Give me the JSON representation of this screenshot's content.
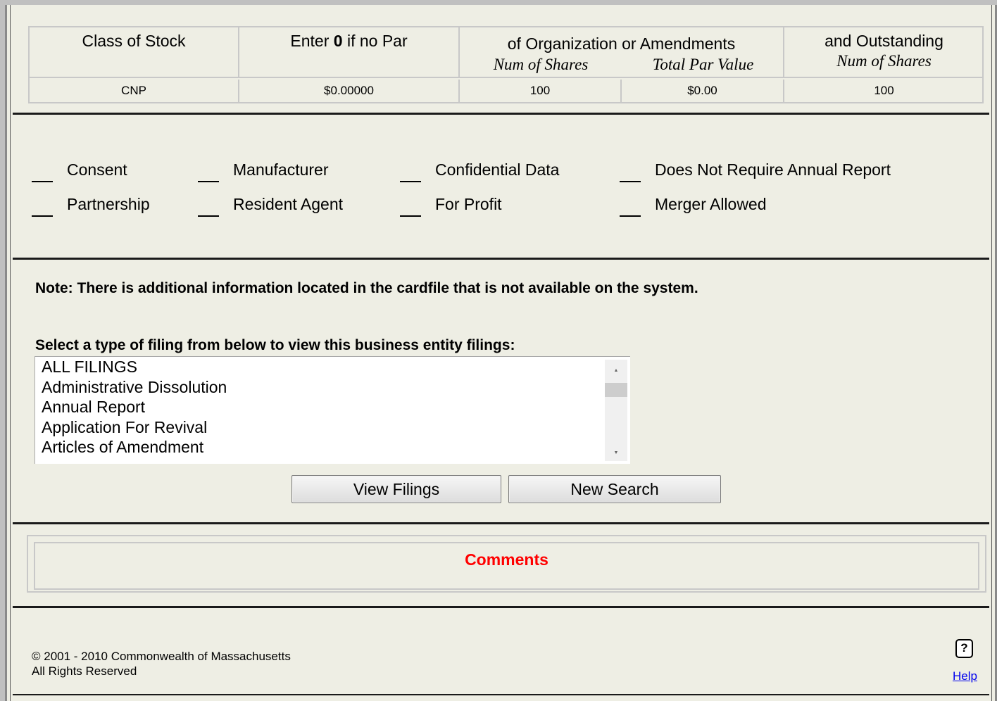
{
  "stock_table": {
    "headers": {
      "class": "Class of Stock",
      "par_prefix": "Enter",
      "par_bold": "0",
      "par_suffix": "if no Par",
      "org": "of Organization or Amendments",
      "org_shares": "Num of Shares",
      "org_par": "Total Par Value",
      "outstanding": "and Outstanding",
      "out_shares": "Num of Shares"
    },
    "row": {
      "class": "CNP",
      "par": "$0.00000",
      "shares": "100",
      "total_par": "$0.00",
      "outstanding": "100"
    }
  },
  "flags": {
    "consent": "Consent",
    "manufacturer": "Manufacturer",
    "confidential": "Confidential Data",
    "no_annual": "Does Not Require Annual Report",
    "partnership": "Partnership",
    "resident_agent": "Resident Agent",
    "for_profit": "For Profit",
    "merger": "Merger Allowed"
  },
  "note": "Note: There is additional information located in the cardfile that is not available on the system.",
  "filings": {
    "label": "Select a type of filing from below to view this business entity filings:",
    "options": [
      "ALL FILINGS",
      "Administrative Dissolution",
      "Annual Report",
      "Application For Revival",
      "Articles of Amendment"
    ],
    "view_button": "View Filings",
    "new_search_button": "New Search"
  },
  "comments": {
    "title": "Comments",
    "title_color": "#ff0000"
  },
  "footer": {
    "copyright": "© 2001 - 2010 Commonwealth of Massachusetts",
    "rights": "All Rights Reserved",
    "help_icon_glyph": "?",
    "help_link": "Help"
  }
}
